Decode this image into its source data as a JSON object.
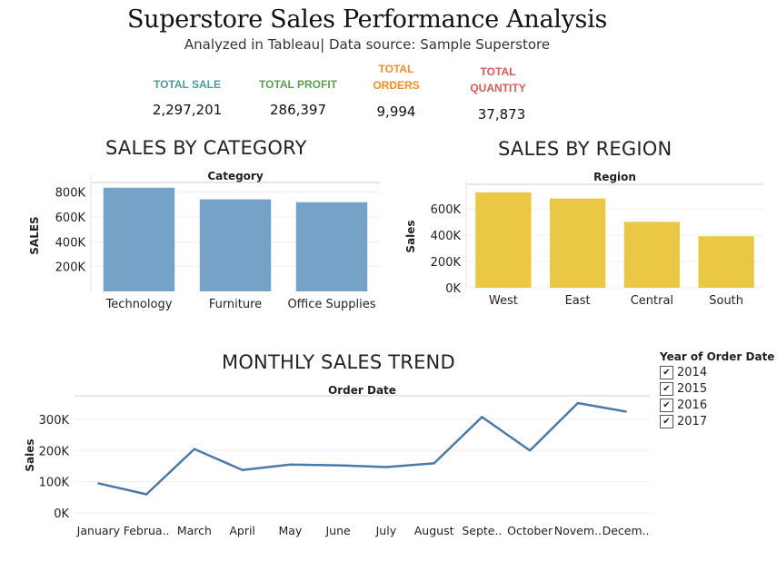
{
  "header": {
    "title": "Superstore Sales Performance Analysis",
    "subtitle": "Analyzed in Tableau| Data source: Sample Superstore"
  },
  "kpis": [
    {
      "label_lines": [
        "TOTAL SALE"
      ],
      "value": "2,297,201",
      "color": "#4a9e9b"
    },
    {
      "label_lines": [
        "TOTAL PROFIT"
      ],
      "value": "286,397",
      "color": "#59a14f"
    },
    {
      "label_lines": [
        "TOTAL",
        "ORDERS"
      ],
      "value": "9,994",
      "color": "#f28e2b"
    },
    {
      "label_lines": [
        "TOTAL",
        "QUANTITY"
      ],
      "value": "37,873",
      "color": "#e15759"
    }
  ],
  "sections": {
    "category": "SALES BY CATEGORY",
    "region": "SALES BY REGION",
    "trend": "MONTHLY SALES TREND"
  },
  "legend": {
    "title": "Year of Order Date",
    "items": [
      {
        "label": "2014",
        "checked": true
      },
      {
        "label": "2015",
        "checked": true
      },
      {
        "label": "2016",
        "checked": true
      },
      {
        "label": "2017",
        "checked": true
      }
    ],
    "check_glyph": "✔"
  },
  "chart_data": [
    {
      "type": "bar",
      "header": "Category",
      "ylabel": "SALES",
      "categories": [
        "Technology",
        "Furniture",
        "Office Supplies"
      ],
      "values": [
        836154,
        741999,
        719047
      ],
      "ylim": [
        0,
        900000
      ],
      "yticks": [
        200000,
        400000,
        600000,
        800000
      ],
      "ytick_labels": [
        "200K",
        "400K",
        "600K",
        "800K"
      ],
      "color": "#76a2c8",
      "grid": true
    },
    {
      "type": "bar",
      "header": "Region",
      "ylabel": "Sales",
      "categories": [
        "West",
        "East",
        "Central",
        "South"
      ],
      "values": [
        725458,
        678781,
        501240,
        391722
      ],
      "ylim": [
        0,
        780000
      ],
      "yticks": [
        0,
        200000,
        400000,
        600000
      ],
      "ytick_labels": [
        "0K",
        "200K",
        "400K",
        "600K"
      ],
      "color": "#eac745",
      "grid": true
    },
    {
      "type": "line",
      "header": "Order Date",
      "ylabel": "Sales",
      "categories": [
        "January",
        "Februa..",
        "March",
        "April",
        "May",
        "June",
        "July",
        "August",
        "Septe..",
        "October",
        "Novem..",
        "Decem.."
      ],
      "values": [
        94925,
        59751,
        205005,
        137762,
        155029,
        152718,
        147238,
        159044,
        307650,
        200322,
        352461,
        325294
      ],
      "ylim": [
        0,
        370000
      ],
      "yticks": [
        0,
        100000,
        200000,
        300000
      ],
      "ytick_labels": [
        "0K",
        "100K",
        "200K",
        "300K"
      ],
      "color": "#4e79a7",
      "grid": true
    }
  ]
}
